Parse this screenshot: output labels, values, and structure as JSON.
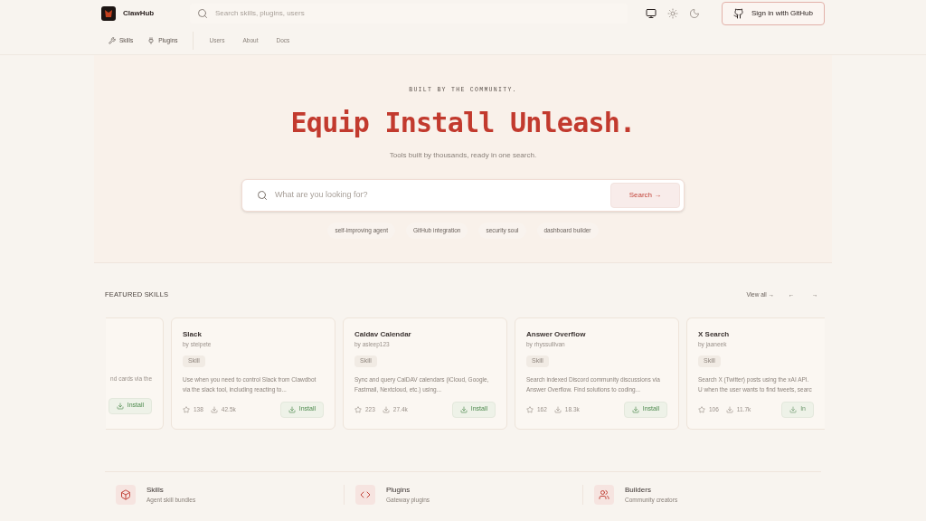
{
  "header": {
    "brand": "ClawHub",
    "search": {
      "placeholder": "Search skills, plugins, users"
    },
    "theme_modes": [
      {
        "kind": "system",
        "selected": true
      },
      {
        "kind": "light",
        "selected": false
      },
      {
        "kind": "dark",
        "selected": false
      }
    ],
    "sign_in": "Sign in with GitHub"
  },
  "nav": [
    {
      "label": "Skills",
      "kind": "section"
    },
    {
      "label": "Plugins",
      "kind": "section"
    },
    {
      "label": "Users",
      "kind": "page"
    },
    {
      "label": "About",
      "kind": "page"
    },
    {
      "label": "Docs",
      "kind": "page"
    }
  ],
  "hero": {
    "eyebrow": "BUILT BY THE COMMUNITY.",
    "title": "Equip Install Unleash.",
    "subtitle": "Tools built by thousands, ready in one search.",
    "search": {
      "placeholder": "What are you looking for?",
      "button": "Search →"
    },
    "suggestions": [
      "self-improving agent",
      "GitHub integration",
      "security soul",
      "dashboard builder"
    ]
  },
  "featured": {
    "heading": "FEATURED SKILLS",
    "view_all": "View all →",
    "prev": "←",
    "next": "→",
    "cards": [
      {
        "kind": "cut_left",
        "description": "nd cards via the",
        "install": "Install"
      },
      {
        "kind": "full",
        "title": "Slack",
        "author": "by steipete",
        "tag": "Skill",
        "description": "Use when you need to control Slack from Clawdbot via the slack tool, including reacting to...",
        "stars": "138",
        "downloads": "42.5k",
        "install": "Install"
      },
      {
        "kind": "full",
        "title": "Caldav Calendar",
        "author": "by asleep123",
        "tag": "Skill",
        "description": "Sync and query CalDAV calendars (iCloud, Google, Fastmail, Nextcloud, etc.) using...",
        "stars": "223",
        "downloads": "27.4k",
        "install": "Install"
      },
      {
        "kind": "full",
        "title": "Answer Overflow",
        "author": "by rhyssullivan",
        "tag": "Skill",
        "description": "Search indexed Discord community discussions via Answer Overflow. Find solutions to coding...",
        "stars": "162",
        "downloads": "18.3k",
        "install": "Install"
      },
      {
        "kind": "cut_right",
        "title": "X Search",
        "author": "by jaaneek",
        "tag": "Skill",
        "description": "Search X (Twitter) posts using the xAI API. U when the user wants to find tweets, searc",
        "stars": "106",
        "downloads": "11.7k",
        "install": "In"
      }
    ]
  },
  "categories": [
    {
      "title": "Skills",
      "subtitle": "Agent skill bundles"
    },
    {
      "title": "Plugins",
      "subtitle": "Gateway plugins"
    },
    {
      "title": "Builders",
      "subtitle": "Community creators"
    }
  ]
}
